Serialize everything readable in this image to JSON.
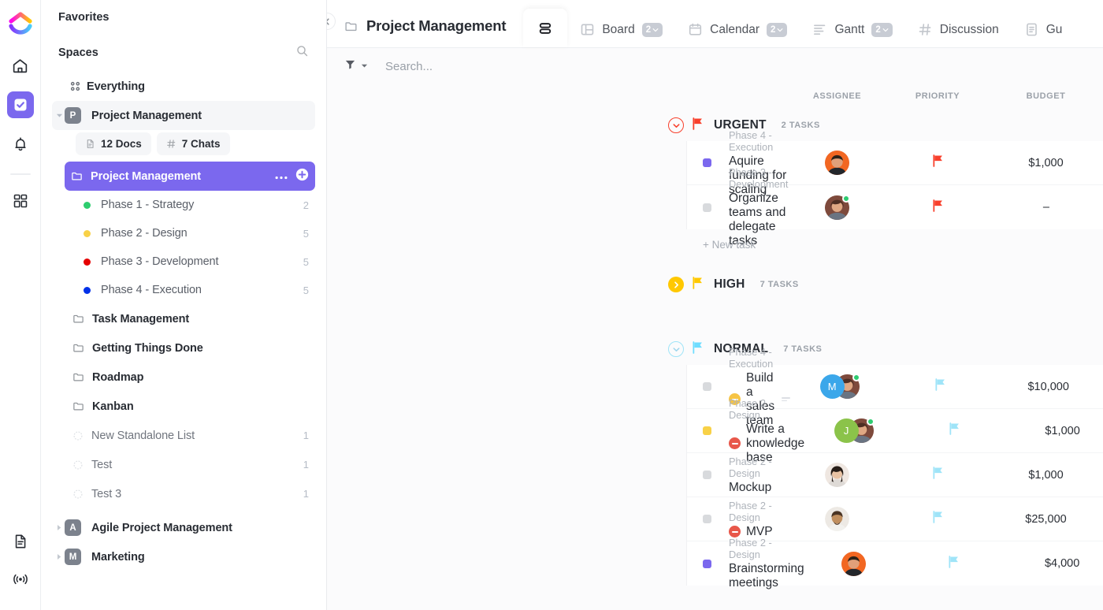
{
  "rail": {
    "logo": "clickup-logo",
    "items": [
      {
        "name": "home-icon",
        "label": "Home",
        "active": false
      },
      {
        "name": "tasks-icon",
        "label": "Tasks",
        "active": true
      },
      {
        "name": "notifications-bell-icon",
        "label": "Notifications",
        "active": false
      },
      {
        "name": "dashboards-icon",
        "label": "Dashboards",
        "active": false
      }
    ],
    "bottom": [
      {
        "name": "docs-icon",
        "label": "Docs"
      },
      {
        "name": "broadcast-icon",
        "label": "Live"
      }
    ]
  },
  "sidebar": {
    "favorites_label": "Favorites",
    "spaces_label": "Spaces",
    "search_icon": "search-icon",
    "everything_label": "Everything",
    "space": {
      "initial": "P",
      "label": "Project Management",
      "chips": [
        {
          "icon": "doc-icon",
          "label": "12 Docs"
        },
        {
          "icon": "hash-icon",
          "label": "7 Chats"
        }
      ]
    },
    "active_list": {
      "label": "Project Management",
      "more_icon": "ellipsis-icon",
      "add_icon": "plus-circle-icon"
    },
    "phases": [
      {
        "label": "Phase 1 - Strategy",
        "count": "2",
        "color": "#2ecd6f"
      },
      {
        "label": "Phase 2 - Design",
        "count": "5",
        "color": "#f8d147"
      },
      {
        "label": "Phase 3 - Development",
        "count": "5",
        "color": "#e50000"
      },
      {
        "label": "Phase 4 - Execution",
        "count": "5",
        "color": "#0231e8"
      }
    ],
    "folders": [
      {
        "label": "Task Management"
      },
      {
        "label": "Getting Things Done"
      },
      {
        "label": "Roadmap"
      },
      {
        "label": "Kanban"
      }
    ],
    "standalone_lists": [
      {
        "label": "New Standalone List",
        "count": "1"
      },
      {
        "label": "Test",
        "count": "1"
      },
      {
        "label": "Test 3",
        "count": "1"
      }
    ],
    "other_spaces": [
      {
        "initial": "A",
        "label": "Agile Project Management"
      },
      {
        "initial": "M",
        "label": "Marketing"
      }
    ]
  },
  "header": {
    "collapse_icon": "chevron-left-icon",
    "view_title": "Project Management",
    "view_title_icon": "folder-icon",
    "tabs": [
      {
        "label": "",
        "icon": "list-icon",
        "badge": "",
        "active": true
      },
      {
        "label": "Board",
        "icon": "board-icon",
        "badge": "2",
        "active": false
      },
      {
        "label": "Calendar",
        "icon": "calendar-icon",
        "badge": "2",
        "active": false
      },
      {
        "label": "Gantt",
        "icon": "gantt-icon",
        "badge": "2",
        "active": false
      },
      {
        "label": "Discussion",
        "icon": "hash-icon",
        "badge": "",
        "active": false
      },
      {
        "label": "Gu",
        "icon": "doc-icon",
        "badge": "",
        "active": false
      }
    ]
  },
  "toolbar": {
    "filter_icon": "filter-icon",
    "filter_chevron_icon": "chevron-down-icon",
    "search_placeholder": "Search..."
  },
  "table": {
    "columns": {
      "assignee": "ASSIGNEE",
      "priority": "PRIORITY",
      "budget": "BUDGET"
    },
    "new_task_label": "+ New task",
    "groups": [
      {
        "name": "URGENT",
        "count_label": "2 TASKS",
        "color": "#f8402c",
        "expanded": true,
        "tasks": [
          {
            "parent": "Phase 4 - Execution",
            "name": "Aquire funding for scaling",
            "status_color": "#7b68ee",
            "blocked": null,
            "priority_color": "#f8402c",
            "budget": "$1,000",
            "assignees": [
              {
                "type": "photo",
                "skin": "#e8734a",
                "hair": "#3a2418",
                "status": false
              }
            ]
          },
          {
            "parent": "Phase 3 - Development",
            "name": "Organize teams and delegate tasks",
            "status_color": "#d8dadd",
            "blocked": null,
            "priority_color": "#f8402c",
            "budget": "–",
            "assignees": [
              {
                "type": "photo",
                "skin": "#8d5b4c",
                "hair": "#4a2a20",
                "status": true
              }
            ]
          }
        ]
      },
      {
        "name": "HIGH",
        "count_label": "7 TASKS",
        "color": "#ffc800",
        "expanded": false,
        "tasks": []
      },
      {
        "name": "NORMAL",
        "count_label": "7 TASKS",
        "color": "#6fddff",
        "expanded": true,
        "tasks": [
          {
            "parent": "Phase 4 - Execution",
            "name": "Build a sales team",
            "status_color": "#d8dadd",
            "blocked": "#f6c445",
            "subtasks": true,
            "priority_color": "#9fe4f8",
            "budget": "$10,000",
            "assignees": [
              {
                "type": "initial",
                "label": "M",
                "bg": "#3ba7ea",
                "status": false
              },
              {
                "type": "photo",
                "skin": "#8d5b4c",
                "hair": "#4a2a20",
                "status": true
              }
            ]
          },
          {
            "parent": "Phase 2 - Design",
            "name": "Write a knowledge base",
            "status_color": "#f8d147",
            "blocked": "#e8574a",
            "priority_color": "#9fe4f8",
            "budget": "$1,000",
            "assignees": [
              {
                "type": "initial",
                "label": "J",
                "bg": "#8bc34a",
                "status": false
              },
              {
                "type": "photo",
                "skin": "#8d5b4c",
                "hair": "#4a2a20",
                "status": true
              }
            ]
          },
          {
            "parent": "Phase 2 - Design",
            "name": "Mockup",
            "status_color": "#d8dadd",
            "blocked": null,
            "priority_color": "#9fe4f8",
            "budget": "$1,000",
            "assignees": [
              {
                "type": "photo",
                "skin": "#e6c3a5",
                "hair": "#2b2119",
                "status": false
              }
            ]
          },
          {
            "parent": "Phase 2 - Design",
            "name": "MVP",
            "status_color": "#d8dadd",
            "blocked": "#e8574a",
            "priority_color": "#9fe4f8",
            "budget": "$25,000",
            "assignees": [
              {
                "type": "photo",
                "skin": "#b08050",
                "hair": "#3a2a1e",
                "status": false
              }
            ]
          },
          {
            "parent": "Phase 2 - Design",
            "name": "Brainstorming meetings",
            "status_color": "#7b68ee",
            "blocked": null,
            "priority_color": "#9fe4f8",
            "budget": "$4,000",
            "assignees": [
              {
                "type": "photo",
                "skin": "#e8734a",
                "hair": "#3a2418",
                "status": false
              }
            ]
          }
        ]
      }
    ]
  }
}
